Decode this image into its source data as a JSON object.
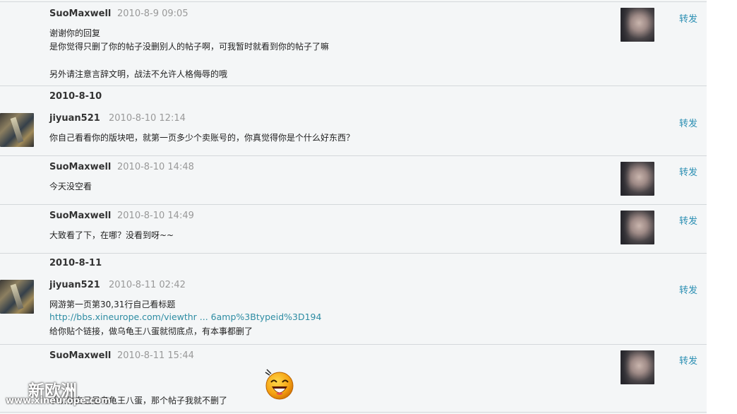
{
  "action_label": "转发",
  "messages": [
    {
      "user": "SuoMaxwell",
      "time": "2010-8-9 09:05",
      "lines": [
        "谢谢你的回复",
        "是你觉得只删了你的帖子没删别人的帖子啊，可我暂时就看到你的帖子了嘛",
        "另外请注意言辞文明，战法不允许人格侮辱的哦"
      ]
    },
    {
      "user": "jiyuan521",
      "time": "2010-8-10 12:14",
      "lines": [
        "你自己看看你的版块吧，就第一页多少个卖账号的，你真觉得你是个什么好东西？"
      ]
    },
    {
      "user": "SuoMaxwell",
      "time": "2010-8-10 14:48",
      "lines": [
        "今天没空看"
      ]
    },
    {
      "user": "SuoMaxwell",
      "time": "2010-8-10 14:49",
      "lines": [
        "大致看了下，在哪？没看到呀~~"
      ]
    },
    {
      "user": "jiyuan521",
      "time": "2010-8-11 02:42",
      "lines": [
        "网游第一页第30,31行自己看标题",
        "http://bbs.xineurope.com/viewthr ... 6amp%3Btypeid%3D194",
        "给你贴个链接，做乌龟王八蛋就彻底点，有本事都删了"
      ]
    },
    {
      "user": "SuoMaxwell",
      "time": "2010-8-11 15:44",
      "lines": [
        "承认你自己是乌龟王八蛋，那个帖子我就不删了"
      ]
    }
  ],
  "date_separators": [
    "2010-8-10",
    "2010-8-11"
  ],
  "watermark": {
    "title": "新欧洲",
    "url": "www.xineurope.com"
  },
  "colors": {
    "link": "#2d8ca3",
    "action": "#2b8fb3",
    "background": "#f4f6f7",
    "divider": "#d4d8db"
  }
}
